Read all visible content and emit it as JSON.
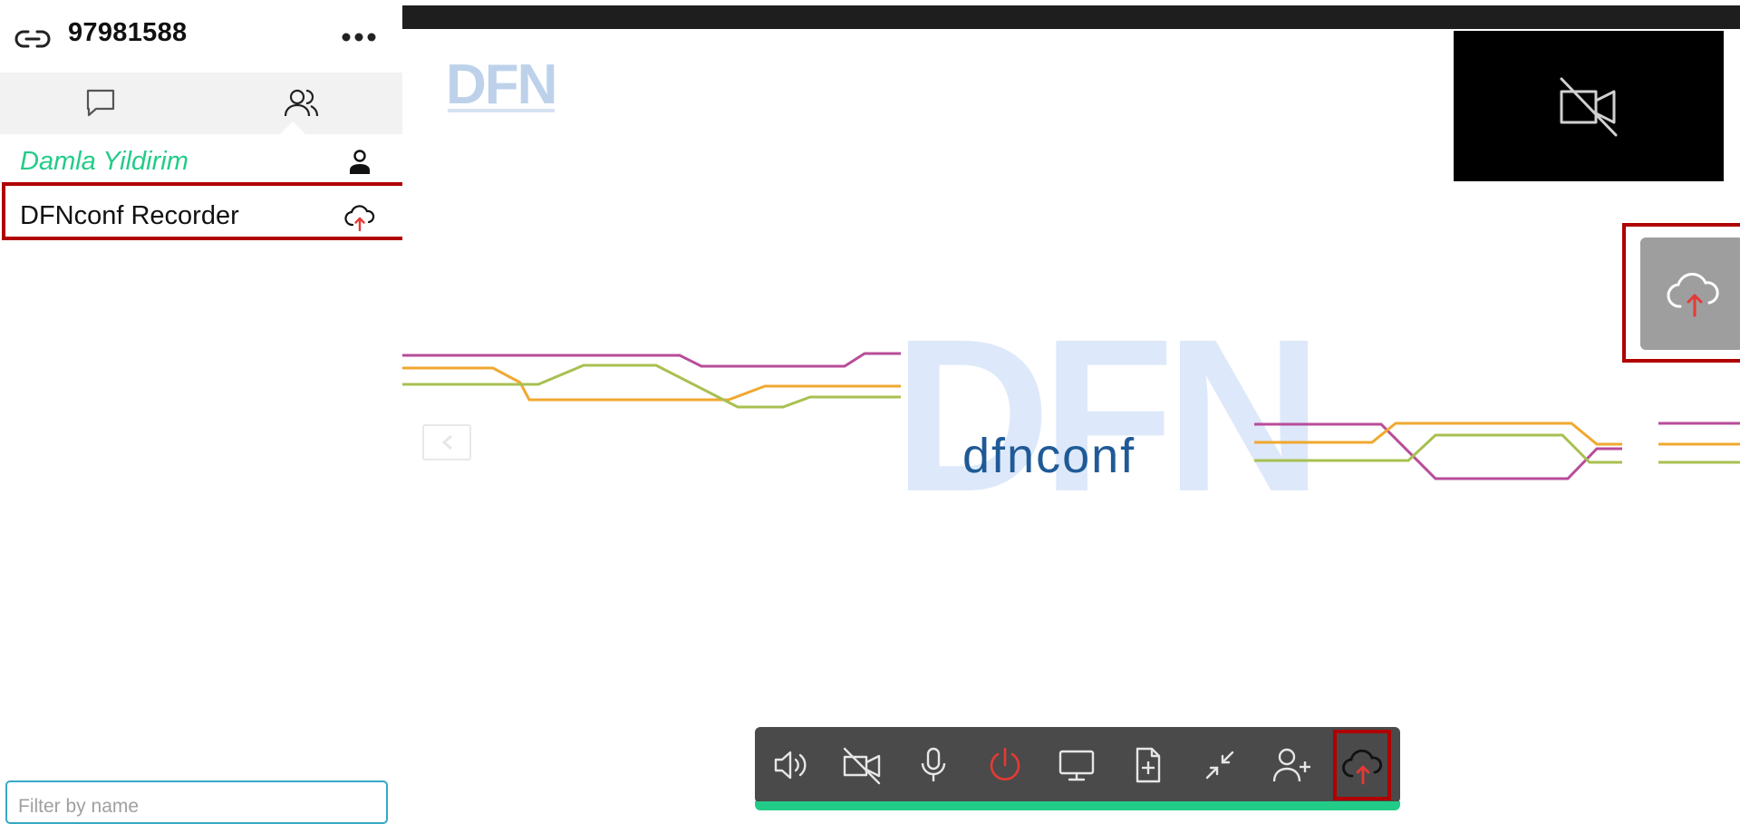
{
  "sidebar": {
    "meeting_id": "97981588",
    "tabs": [
      {
        "icon": "chat-icon"
      },
      {
        "icon": "participants-icon"
      }
    ],
    "participants": [
      {
        "name": "Damla Yildirim",
        "icon": "user-icon",
        "color": "#22cc88"
      },
      {
        "name": "DFNconf Recorder",
        "icon": "cloud-upload-icon"
      }
    ],
    "filter": {
      "placeholder": "Filter by name",
      "value": ""
    }
  },
  "main": {
    "logo_small": "DFN",
    "presentation": {
      "logo_big": "DFN",
      "label": "dfnconf"
    },
    "toolbar": {
      "buttons": [
        {
          "icon": "speaker-icon"
        },
        {
          "icon": "camera-off-icon"
        },
        {
          "icon": "microphone-icon"
        },
        {
          "icon": "power-icon",
          "color": "#e53935"
        },
        {
          "icon": "screen-share-icon"
        },
        {
          "icon": "add-file-icon"
        },
        {
          "icon": "minimize-icon"
        },
        {
          "icon": "add-participant-icon"
        },
        {
          "icon": "cloud-upload-icon"
        }
      ]
    }
  },
  "colors": {
    "accent_green": "#22cc88",
    "highlight_red": "#b00000",
    "line_magenta": "#b84c9a",
    "line_orange": "#f0a830",
    "line_green": "#a8c050",
    "logo_blue": "#1f5a96"
  }
}
